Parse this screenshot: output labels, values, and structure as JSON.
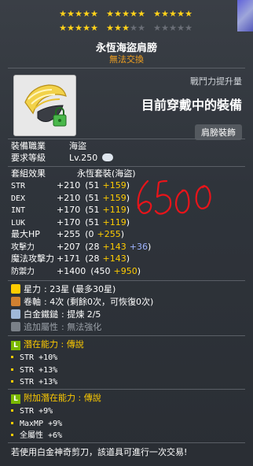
{
  "stars_filled": 23,
  "stars_total": 30,
  "item": {
    "name": "永恆海盜肩膀",
    "trade_status": "無法交換",
    "combat_power_label": "戰鬥力提升量",
    "combat_power_value": "目前穿戴中的裝備",
    "slot": "肩膀裝飾"
  },
  "requirements": [
    {
      "label": "裝備職業",
      "value": "海盜"
    },
    {
      "label": "要求等級",
      "value": "Lv.250"
    }
  ],
  "set_effect": {
    "label": "套組效果",
    "value": "永恆套裝(海盜)"
  },
  "stats": [
    {
      "name": "STR",
      "total": "+210",
      "base": "(51",
      "bonus": "+159",
      "extra": "",
      "close": ")"
    },
    {
      "name": "DEX",
      "total": "+210",
      "base": "(51",
      "bonus": "+159",
      "extra": "",
      "close": ")"
    },
    {
      "name": "INT",
      "total": "+170",
      "base": "(51",
      "bonus": "+119",
      "extra": "",
      "close": ")"
    },
    {
      "name": "LUK",
      "total": "+170",
      "base": "(51",
      "bonus": "+119",
      "extra": "",
      "close": ")"
    },
    {
      "name": "最大HP",
      "total": "+255",
      "base": "(0",
      "bonus": "+255",
      "extra": "",
      "close": ")"
    },
    {
      "name": "攻擊力",
      "total": "+207",
      "base": "(28",
      "bonus": "+143",
      "extra": "+36",
      "close": ")"
    },
    {
      "name": "魔法攻擊力",
      "total": "+171",
      "base": "(28",
      "bonus": "+143",
      "extra": "",
      "close": ")"
    },
    {
      "name": "防禦力",
      "total": "+1400",
      "base": "(450",
      "bonus": "+950",
      "extra": "",
      "close": ")"
    }
  ],
  "enhance": [
    {
      "label": "星力",
      "value": ": 23星 (最多30星)",
      "icon_color": "#ffcc00"
    },
    {
      "label": "卷軸",
      "value": ": 4次 (剩餘0次，可恢復0次)",
      "icon_color": "#d08030"
    },
    {
      "label": "白金鐵鎚",
      "value": ": 提煉 2/5",
      "icon_color": "#a0b8d8"
    },
    {
      "label": "追加屬性",
      "value": ": 無法強化",
      "icon_color": "#7a8088",
      "grey": true
    }
  ],
  "potential": {
    "title": "潛在能力 : 傳說",
    "lines": [
      "STR +10%",
      "STR +13%",
      "STR +13%"
    ]
  },
  "additional_potential": {
    "title": "附加潛在能力 : 傳說",
    "lines": [
      "STR +9%",
      "MaxMP +9%",
      "全屬性 +6%"
    ]
  },
  "footer": "若使用白金神奇剪刀，該道具可進行一次交易!",
  "colors": {
    "star": "#ffd21a",
    "bonus": "#ffcc00",
    "extra": "#9fb4ff",
    "legend": "#7ab800"
  }
}
